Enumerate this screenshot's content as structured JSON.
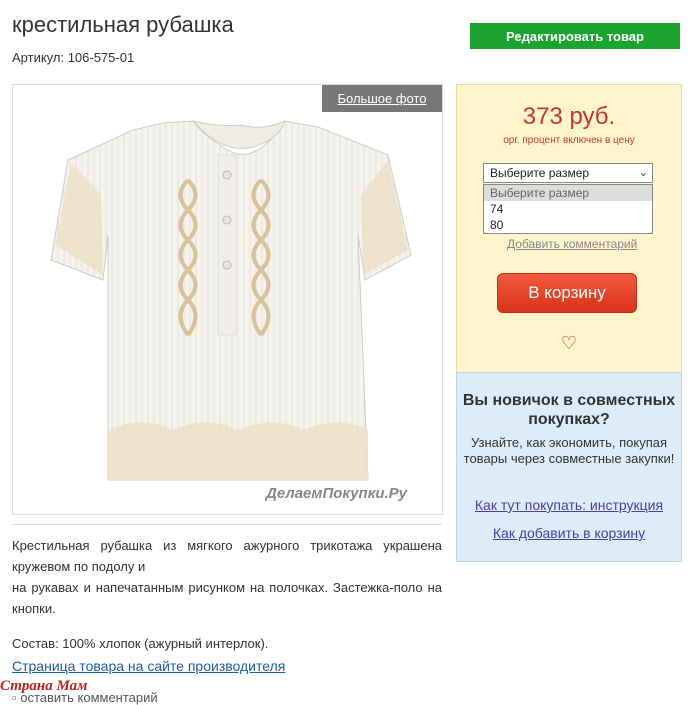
{
  "product": {
    "title": "крестильная рубашка",
    "sku": "Артикул: 106-575-01",
    "edit_label": "Редактировать товар",
    "big_photo_label": "Большое фото",
    "watermark": "ДелаемПокупки.Ру",
    "description_lines": [
      "Крестильная рубашка из мягкого ажурного трикотажа украшена кружевом по подолу и",
      "на рукавах и напечатанным рисунком на полочках. Застежка-поло на кнопки."
    ],
    "composition": "Состав: 100% хлопок (ажурный интерлок).",
    "manufacturer_link": "Страница товара на сайте производителя",
    "comment_link": "оставить комментарий",
    "site_logo": "Страна Мам"
  },
  "purchase": {
    "price": "373 руб.",
    "price_note": "орг. процент включен в цену",
    "size_select_value": "Выберите размер",
    "size_options": [
      "Выберите размер",
      "74",
      "80"
    ],
    "add_comment": "Добавить комментарий",
    "cart_label": "В корзину",
    "heart_glyph": "♡"
  },
  "newbie": {
    "title": "Вы новичок в совместных покупках?",
    "text": "Узнайте, как экономить, покупая товары через совместные закупки!",
    "how_to_buy": "Как тут покупать: инструкция",
    "how_to_add": "Как добавить в корзину"
  },
  "colors": {
    "edit_button": "#1aa32e",
    "price": "#c0392b",
    "cart_button": "#e04428",
    "price_box_bg": "#fff4cc",
    "newbie_box_bg": "#dcedf9",
    "link": "#1a5fa8"
  }
}
